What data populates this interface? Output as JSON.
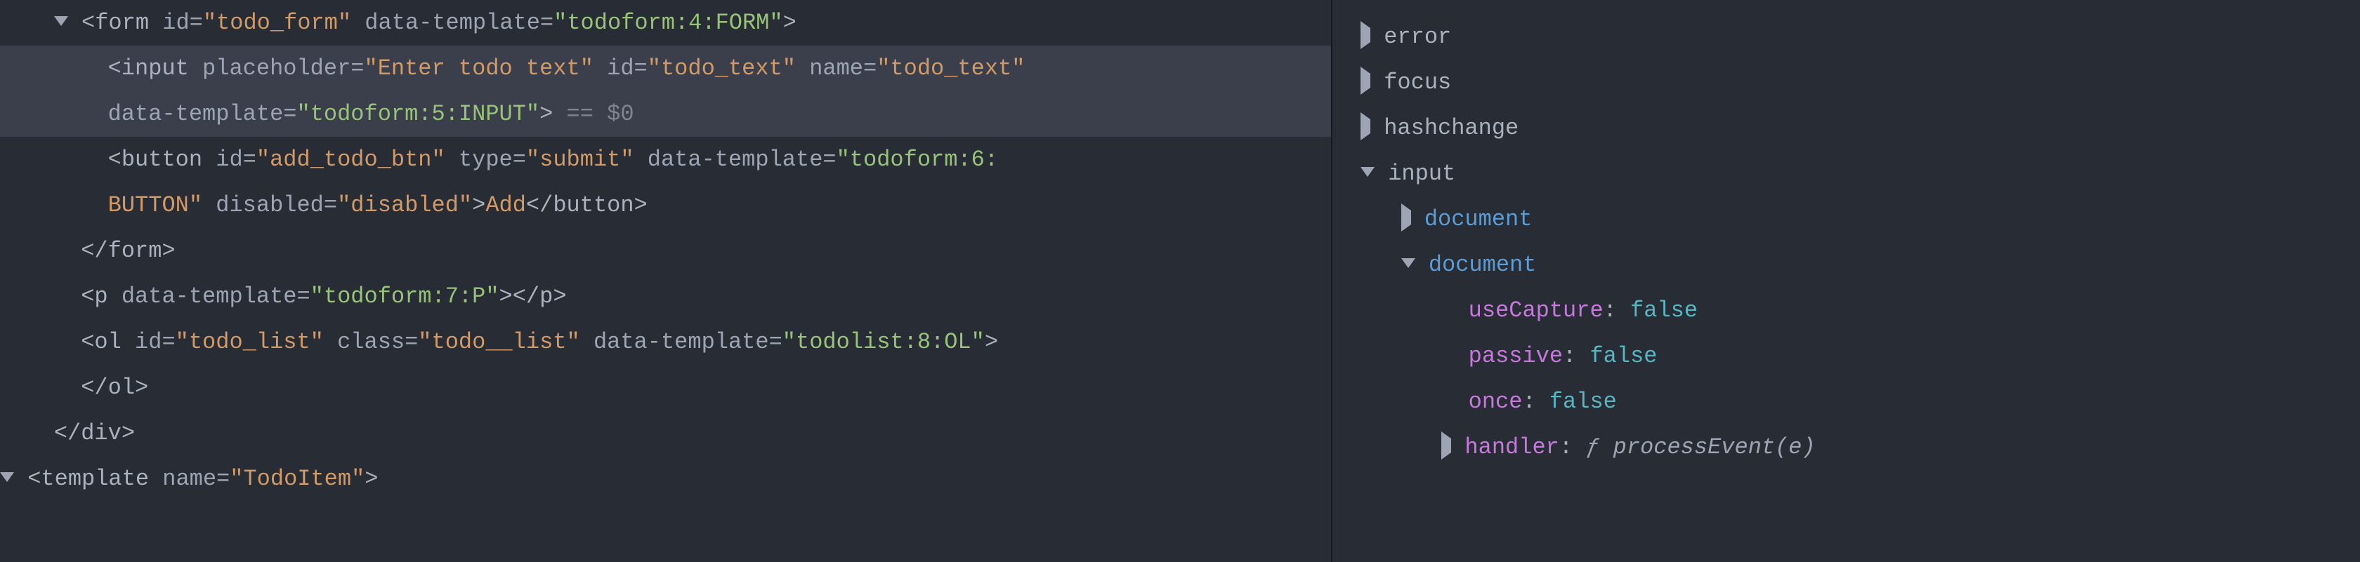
{
  "dom": {
    "line1": {
      "form_open": "<form",
      "id_attr": " id=",
      "id_val": "\"todo_form\"",
      "dt_attr": " data-template=",
      "dt_val": "\"todoform:4:FORM\"",
      "close": ">"
    },
    "line2": {
      "input_open": "<input",
      "ph_attr": " placeholder=",
      "ph_val": "\"Enter todo text\"",
      "id_attr": " id=",
      "id_val": "\"todo_text\"",
      "name_attr": " name=",
      "name_val": "\"todo_text\""
    },
    "line3": {
      "dt_attr": "data-template=",
      "dt_val": "\"todoform:5:INPUT\"",
      "close": ">",
      "selected": " == $0"
    },
    "line4": {
      "btn_open": "<button",
      "id_attr": " id=",
      "id_val": "\"add_todo_btn\"",
      "type_attr": " type=",
      "type_val": "\"submit\"",
      "dt_attr": " data-template=",
      "dt_val": "\"todoform:6:"
    },
    "line5": {
      "btn_cont": "BUTTON\"",
      "dis_attr": " disabled=",
      "dis_val": "\"disabled\"",
      "close": ">",
      "text": "Add",
      "btn_close": "</button>"
    },
    "line6": {
      "form_close": "</form>"
    },
    "line7": {
      "p_open": "<p",
      "dt_attr": " data-template=",
      "dt_val": "\"todoform:7:P\"",
      "close": ">",
      "p_close": "</p>"
    },
    "line8": {
      "ol_open": "<ol",
      "id_attr": " id=",
      "id_val": "\"todo_list\"",
      "cls_attr": " class=",
      "cls_val": "\"todo__list\"",
      "dt_attr": " data-template=",
      "dt_val": "\"todolist:8:OL\"",
      "close": ">"
    },
    "line9": {
      "ol_close": "</ol>"
    },
    "line10": {
      "div_close": "</div>"
    },
    "line11": {
      "tmpl_open": "<template",
      "name_attr": " name=",
      "name_val": "\"TodoItem\"",
      "close": ">"
    }
  },
  "events": {
    "top": [
      "error",
      "focus",
      "hashchange"
    ],
    "input_label": "input",
    "doc1": "document",
    "doc2": "document",
    "useCapture": {
      "k": "useCapture",
      "sep": ": ",
      "v": "false"
    },
    "passive": {
      "k": "passive",
      "sep": ": ",
      "v": "false"
    },
    "once": {
      "k": "once",
      "sep": ": ",
      "v": "false"
    },
    "handler": {
      "k": "handler",
      "sep": ": ",
      "f": "ƒ ",
      "fn": "processEvent(e)"
    }
  }
}
